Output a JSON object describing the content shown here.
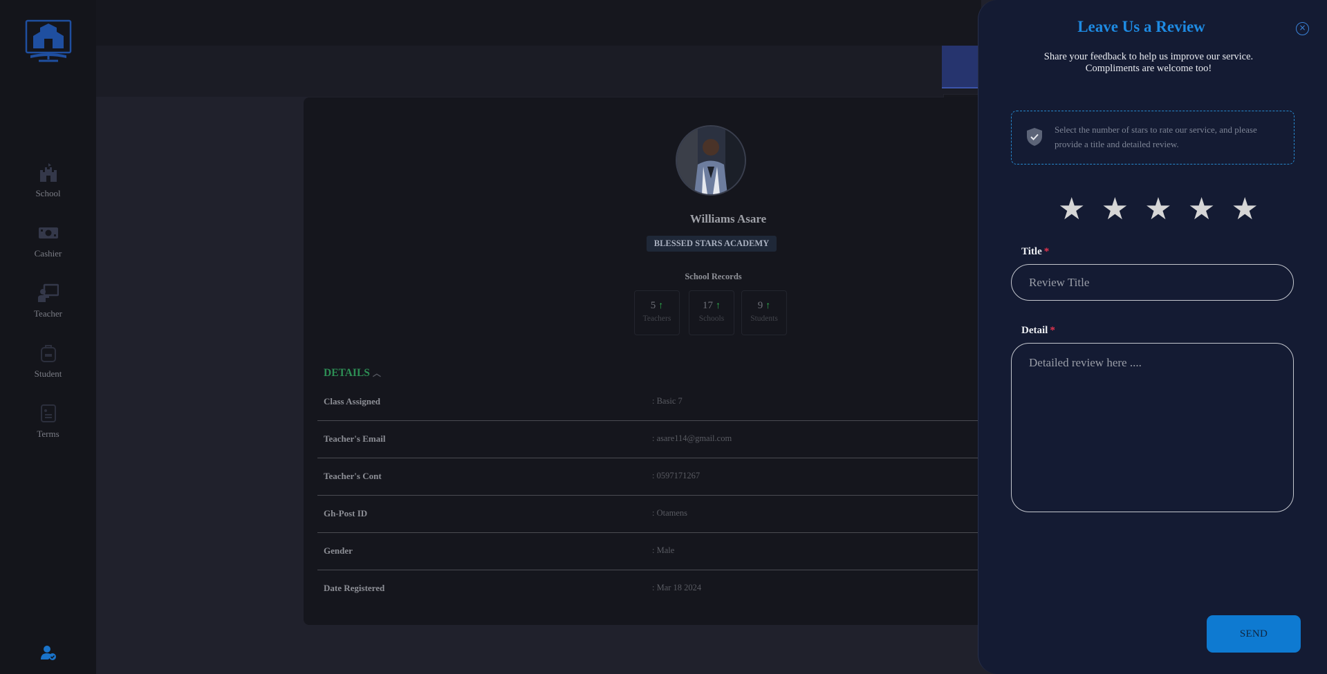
{
  "sidebar": {
    "items": [
      {
        "label": "School",
        "icon": "castle-icon"
      },
      {
        "label": "Cashier",
        "icon": "money-icon"
      },
      {
        "label": "Teacher",
        "icon": "chalkboard-teacher-icon"
      },
      {
        "label": "Student",
        "icon": "backpack-icon"
      },
      {
        "label": "Terms",
        "icon": "document-icon"
      }
    ]
  },
  "profile": {
    "name": "Williams Asare",
    "school": "BLESSED STARS ACADEMY",
    "records_label": "School Records",
    "stats": [
      {
        "value": "5",
        "label": "Teachers"
      },
      {
        "value": "17",
        "label": "Schools"
      },
      {
        "value": "9",
        "label": "Students"
      }
    ],
    "details_heading": "DETAILS",
    "details": [
      {
        "key": "Class Assigned",
        "value": ": Basic 7"
      },
      {
        "key": "Teacher's Email",
        "value": ": asare114@gmail.com"
      },
      {
        "key": "Teacher's Cont",
        "value": ": 0597171267"
      },
      {
        "key": "Gh-Post ID",
        "value": ": Otamens"
      },
      {
        "key": "Gender",
        "value": ": Male"
      },
      {
        "key": "Date Registered",
        "value": ": Mar 18 2024"
      }
    ]
  },
  "review": {
    "title": "Leave Us a Review",
    "subtitle_line1": "Share your feedback to help us improve our service.",
    "subtitle_line2": "Compliments are welcome too!",
    "info": "Select the number of stars to rate our service, and please provide a title and detailed review.",
    "stars": [
      "★",
      "★",
      "★",
      "★",
      "★"
    ],
    "title_label": "Title",
    "title_placeholder": "Review Title",
    "detail_label": "Detail",
    "detail_placeholder": "Detailed review here ....",
    "required_mark": "*",
    "send_label": "SEND",
    "close_glyph": "×"
  },
  "colors": {
    "accent": "#1e8be3",
    "send": "#0e7ad1",
    "details_heading": "#2d8f55",
    "required": "#e3344e",
    "panel_bg": "#141b33"
  }
}
